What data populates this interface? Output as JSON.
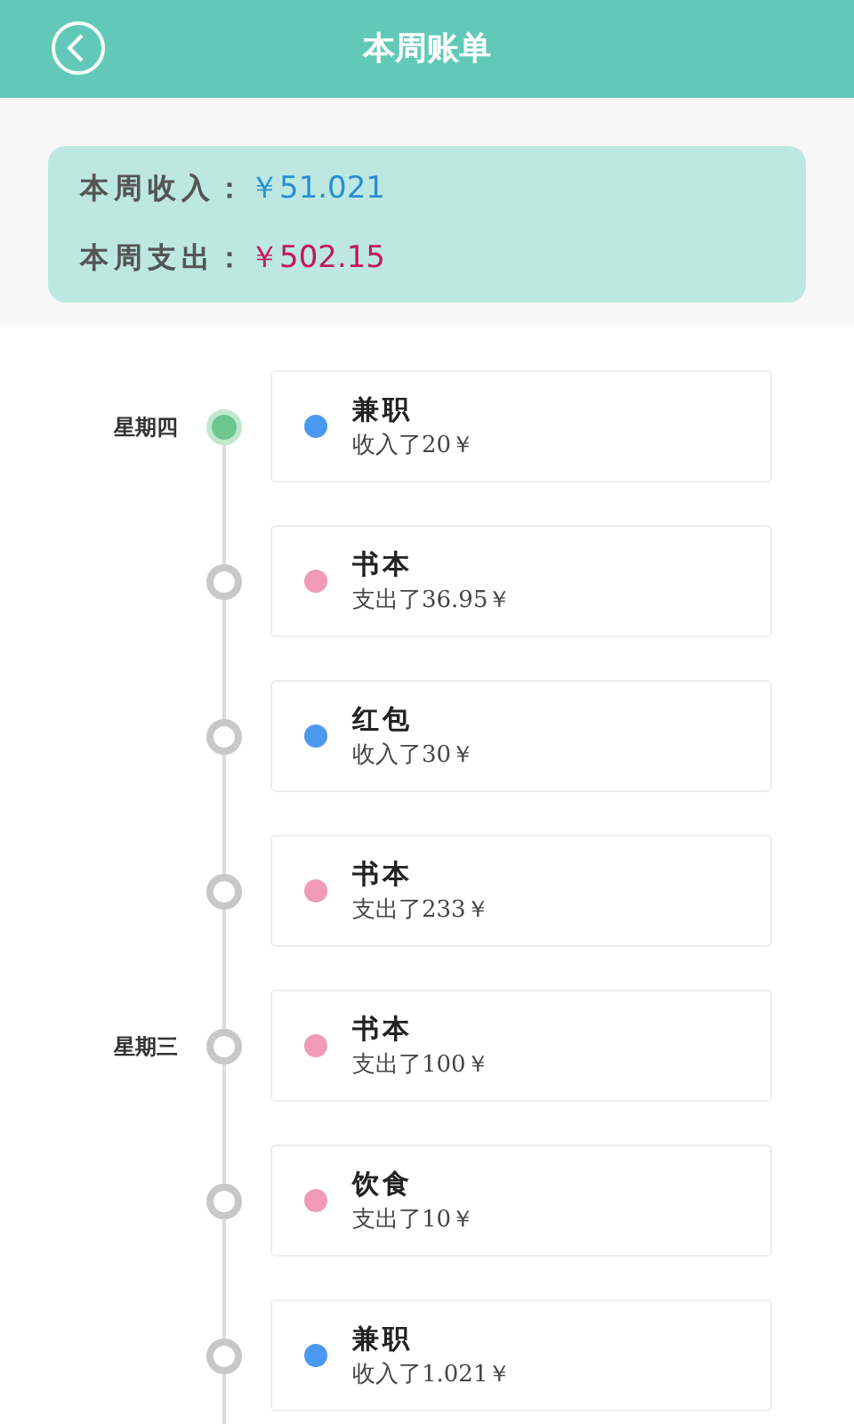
{
  "header": {
    "title": "本周账单"
  },
  "summary": [
    {
      "label": "本周收入：",
      "amount": "￥51.021",
      "color": "#2a8fd0"
    },
    {
      "label": "本周支出：",
      "amount": "￥502.15",
      "color": "#c2185b"
    }
  ],
  "timeline": [
    {
      "day": "星期四",
      "selected": true,
      "title": "兼职",
      "detail": "收入了20￥",
      "color": "#4a98f0"
    },
    {
      "selected": false,
      "title": "书本",
      "detail": "支出了36.95￥",
      "color": "#f09ab8"
    },
    {
      "selected": false,
      "title": "红包",
      "detail": "收入了30￥",
      "color": "#4a98f0"
    },
    {
      "selected": false,
      "title": "书本",
      "detail": "支出了233￥",
      "color": "#f09ab8"
    },
    {
      "day": "星期三",
      "selected": false,
      "title": "书本",
      "detail": "支出了100￥",
      "color": "#f09ab8"
    },
    {
      "selected": false,
      "title": "饮食",
      "detail": "支出了10￥",
      "color": "#f09ab8"
    },
    {
      "selected": false,
      "title": "兼职",
      "detail": "收入了1.021￥",
      "color": "#4a98f0"
    }
  ]
}
